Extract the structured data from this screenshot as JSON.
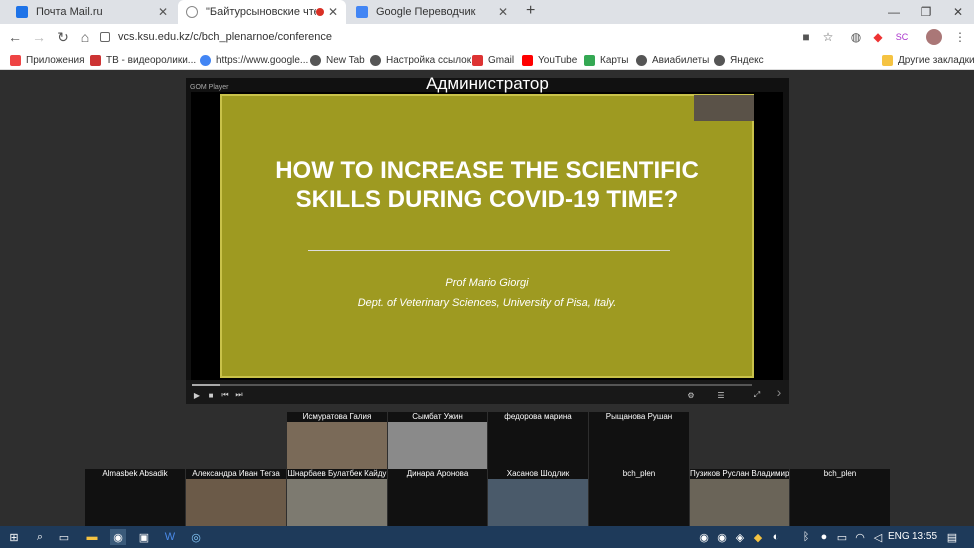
{
  "browser": {
    "tabs": [
      {
        "label": "Почта Mail.ru",
        "icon": "mail-icon"
      },
      {
        "label": "\"Байтурсыновские чтения",
        "icon": "conference-icon",
        "recording": true
      },
      {
        "label": "Google Переводчик",
        "icon": "translate-icon"
      }
    ],
    "url": "vcs.ksu.edu.kz/c/bch_plenarnoe/conference"
  },
  "bookmarks": [
    {
      "label": "Приложения",
      "icon": "apps-grid-icon"
    },
    {
      "label": "ТВ - видеоролики...",
      "icon": "tv-icon"
    },
    {
      "label": "https://www.google...",
      "icon": "google-icon"
    },
    {
      "label": "New Tab",
      "icon": "globe-icon"
    },
    {
      "label": "Настройка ссылок",
      "icon": "globe-icon"
    },
    {
      "label": "Gmail",
      "icon": "gmail-icon"
    },
    {
      "label": "YouTube",
      "icon": "youtube-icon"
    },
    {
      "label": "Карты",
      "icon": "maps-icon"
    },
    {
      "label": "Авиабилеты",
      "icon": "globe-icon"
    },
    {
      "label": "Яндекс",
      "icon": "globe-icon"
    }
  ],
  "other_bookmarks": "Другие закладки",
  "conference": {
    "presenter_label": "Администратор",
    "player_name": "GOM Player",
    "slide": {
      "title_line1": "HOW TO INCREASE THE SCIENTIFIC",
      "title_line2": "SKILLS DURING COVID-19 TIME?",
      "author": "Prof Mario Giorgi",
      "dept": "Dept. of Veterinary Sciences, University of Pisa, Italy."
    },
    "playback_progress": 0.05,
    "participants_row1": [
      "Исмуратова Галия",
      "Сымбат Ужин",
      "федорова марина",
      "Рыщанова Рушан"
    ],
    "participants_row2": [
      "Almasbek Absadik",
      "Александра Иван Тегза",
      "Шнарбаев Булатбек Кайду",
      "Динара Аронова",
      "Хасанов Шодлик",
      "bch_plen",
      "Пузиков Руслан Владимир",
      "bch_plen"
    ]
  },
  "taskbar": {
    "language": "ENG",
    "time": "13:55"
  }
}
